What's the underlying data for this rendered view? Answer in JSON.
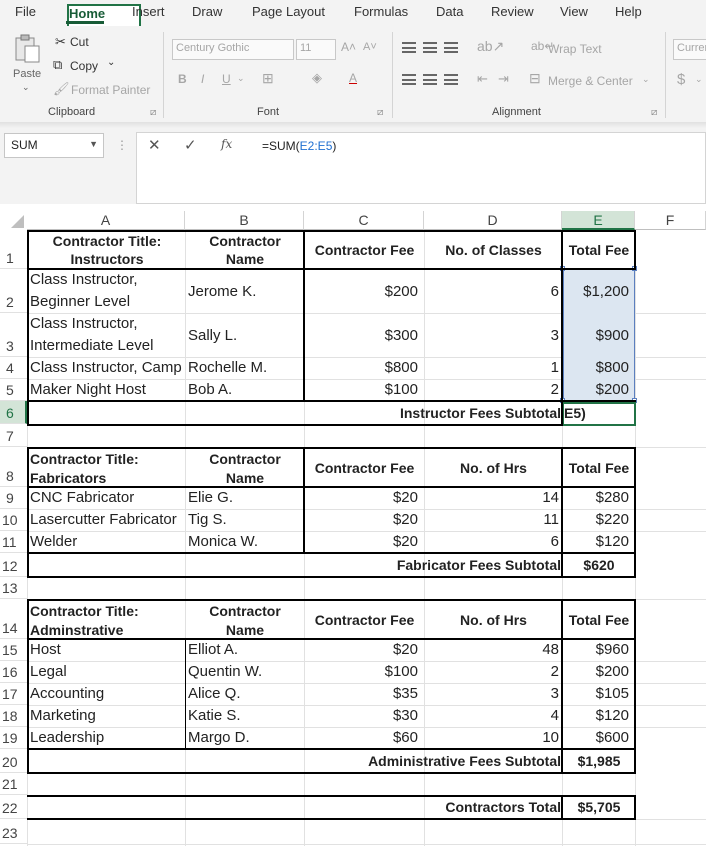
{
  "menu": {
    "file": "File",
    "home": "Home",
    "insert": "Insert",
    "draw": "Draw",
    "page_layout": "Page Layout",
    "formulas": "Formulas",
    "data": "Data",
    "review": "Review",
    "view": "View",
    "help": "Help"
  },
  "ribbon": {
    "paste": "Paste",
    "cut": "Cut",
    "copy": "Copy",
    "format_painter": "Format Painter",
    "clipboard": "Clipboard",
    "font_name": "Century Gothic",
    "font_size": "11",
    "bold": "B",
    "italic": "I",
    "underline": "U",
    "font_group": "Font",
    "wrap_text": "Wrap Text",
    "merge_center": "Merge & Center",
    "alignment_group": "Alignment",
    "number_format": "Curren",
    "currency": "$"
  },
  "formula_bar": {
    "name_box": "SUM",
    "formula_prefix": "=SUM(",
    "formula_ref": "E2:E5",
    "formula_suffix": ")",
    "fx": "fx"
  },
  "columns": [
    "A",
    "B",
    "C",
    "D",
    "E",
    "F"
  ],
  "rows": [
    "1",
    "2",
    "3",
    "4",
    "5",
    "6",
    "7",
    "8",
    "9",
    "10",
    "11",
    "12",
    "13",
    "14",
    "15",
    "16",
    "17",
    "18",
    "19",
    "20",
    "21",
    "22",
    "23"
  ],
  "cells": {
    "a1": "Contractor Title:",
    "a1b": "Instructors",
    "b1": "Contractor",
    "b1b": "Name",
    "c1": "Contractor Fee",
    "d1": "No. of Classes",
    "e1": "Total Fee",
    "a2": "Class Instructor,",
    "a2b": "Beginner Level",
    "b2": "Jerome K.",
    "c2": "$200",
    "d2": "6",
    "e2": "$1,200",
    "a3": "Class Instructor,",
    "a3b": "Intermediate Level",
    "b3": "Sally L.",
    "c3": "$300",
    "d3": "3",
    "e3": "$900",
    "a4": "Class Instructor, Camp",
    "b4": "Rochelle M.",
    "c4": "$800",
    "d4": "1",
    "e4": "$800",
    "a5": "Maker Night Host",
    "b5": "Bob A.",
    "c5": "$100",
    "d5": "2",
    "e5": "$200",
    "d6": "Instructor Fees Subtotal",
    "e6": "E5)",
    "a8": "Contractor Title:",
    "a8b": "Fabricators",
    "b8": "Contractor",
    "b8b": "Name",
    "c8": "Contractor Fee",
    "d8": "No. of Hrs",
    "e8": "Total Fee",
    "a9": "CNC Fabricator",
    "b9": "Elie G.",
    "c9": "$20",
    "d9": "14",
    "e9": "$280",
    "a10": "Lasercutter Fabricator",
    "b10": "Tig S.",
    "c10": "$20",
    "d10": "11",
    "e10": "$220",
    "a11": "Welder",
    "b11": "Monica W.",
    "c11": "$20",
    "d11": "6",
    "e11": "$120",
    "d12": "Fabricator Fees Subtotal",
    "e12": "$620",
    "a14": "Contractor Title:",
    "a14b": "Adminstrative",
    "b14": "Contractor",
    "b14b": "Name",
    "c14": "Contractor Fee",
    "d14": "No. of Hrs",
    "e14": "Total Fee",
    "a15": "Host",
    "b15": "Elliot A.",
    "c15": "$20",
    "d15": "48",
    "e15": "$960",
    "a16": "Legal",
    "b16": "Quentin W.",
    "c16": "$100",
    "d16": "2",
    "e16": "$200",
    "a17": "Accounting",
    "b17": "Alice Q.",
    "c17": "$35",
    "d17": "3",
    "e17": "$105",
    "a18": "Marketing",
    "b18": "Katie S.",
    "c18": "$30",
    "d18": "4",
    "e18": "$120",
    "a19": "Leadership",
    "b19": "Margo D.",
    "c19": "$60",
    "d19": "10",
    "e19": "$600",
    "d20": "Administrative Fees Subtotal",
    "e20": "$1,985",
    "d22": "Contractors Total",
    "e22": "$5,705"
  },
  "icons": {
    "paste": "paste-icon",
    "cut": "scissors-icon",
    "copy": "copy-icon",
    "format_painter": "paintbrush-icon",
    "cancel": "close-icon",
    "enter": "check-icon",
    "insert_function": "fx-icon"
  },
  "colors": {
    "accent": "#217346",
    "selection": "#dce6f1",
    "selection_border": "#5b7fbf"
  }
}
